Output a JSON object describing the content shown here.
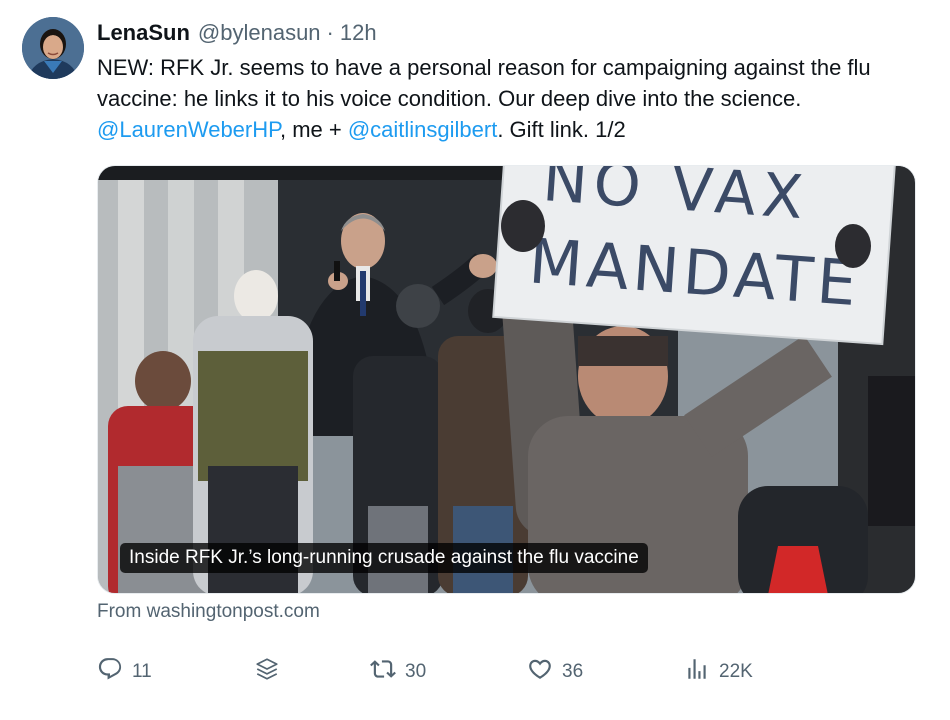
{
  "author": {
    "display_name": "LenaSun",
    "handle": "@bylenasun",
    "separator": "·",
    "time": "12h"
  },
  "tweet": {
    "text_part1": "NEW: RFK Jr. seems to have a personal reason for campaigning against the flu vaccine: he links it to his voice condition. Our deep dive into the science.",
    "mention1": "@LaurenWeberHP",
    "text_part2": ", me + ",
    "mention2": "@caitlinsgilbert",
    "text_part3": ". Gift link. 1/2"
  },
  "media": {
    "sign_line1": "NO VAX",
    "sign_line2": "MANDATE",
    "caption": "Inside RFK Jr.’s long-running crusade against the flu vaccine"
  },
  "source": "From washingtonpost.com",
  "actions": {
    "replies": "11",
    "retweets": "30",
    "likes": "36",
    "views": "22K",
    "icons": [
      "reply-icon",
      "stack-icon",
      "retweet-icon",
      "like-icon",
      "views-icon"
    ]
  },
  "colors": {
    "link": "#1d9bf0",
    "secondary_text": "#536471",
    "primary_text": "#0f1419"
  }
}
